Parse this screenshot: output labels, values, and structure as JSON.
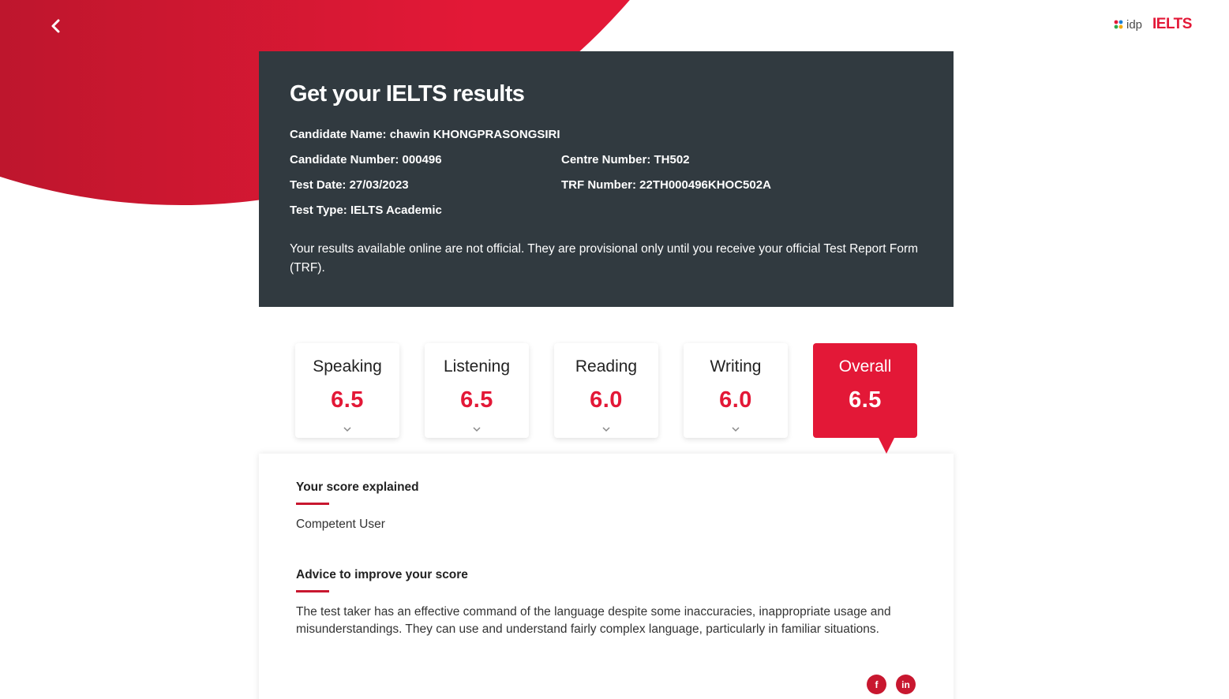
{
  "header": {
    "logo_idp": "idp",
    "logo_ielts": "IELTS"
  },
  "results": {
    "title": "Get your IELTS results",
    "candidate_name": "Candidate Name: chawin KHONGPRASONGSIRI",
    "candidate_number": "Candidate Number: 000496",
    "centre_number": "Centre Number: TH502",
    "test_date": "Test Date: 27/03/2023",
    "trf_number": "TRF Number: 22TH000496KHOC502A",
    "test_type": "Test Type: IELTS Academic",
    "disclaimer": "Your results available online are not official. They are provisional only until you receive your official Test Report Form (TRF)."
  },
  "scores": [
    {
      "label": "Speaking",
      "value": "6.5"
    },
    {
      "label": "Listening",
      "value": "6.5"
    },
    {
      "label": "Reading",
      "value": "6.0"
    },
    {
      "label": "Writing",
      "value": "6.0"
    },
    {
      "label": "Overall",
      "value": "6.5"
    }
  ],
  "explanation": {
    "score_heading": "Your score explained",
    "score_text": "Competent User",
    "advice_heading": "Advice to improve your score",
    "advice_text": "The test taker has an effective command of the language despite some inaccuracies, inappropriate usage and misunderstandings. They can use and understand fairly complex language, particularly in familiar situations."
  },
  "social": {
    "facebook": "f",
    "linkedin": "in"
  },
  "colors": {
    "brand_red": "#e31837",
    "card_dark": "#313a40"
  }
}
